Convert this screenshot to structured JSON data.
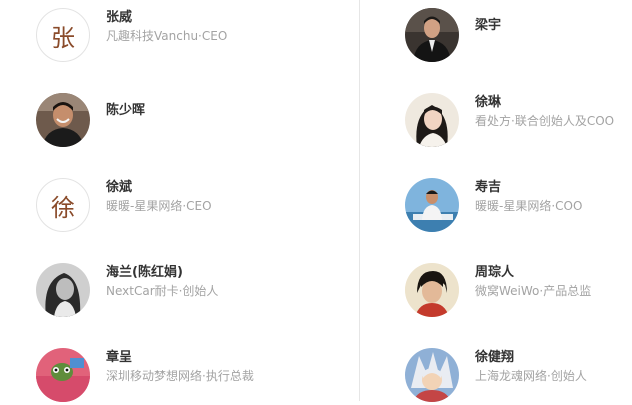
{
  "people": [
    {
      "name": "张威",
      "title": "凡趣科技Vanchu·CEO",
      "avatar_char": "张",
      "avatar_icon": "portrait-photo-icon"
    },
    {
      "name": "梁宇",
      "title": "",
      "avatar_icon": "portrait-photo-icon"
    },
    {
      "name": "陈少晖",
      "title": "",
      "avatar_icon": "portrait-photo-icon"
    },
    {
      "name": "徐琳",
      "title": "看处方·联合创始人及COO",
      "avatar_icon": "portrait-photo-icon"
    },
    {
      "name": "徐斌",
      "title": "暖暖-星果网络·CEO",
      "avatar_char": "徐",
      "avatar_icon": "portrait-photo-icon"
    },
    {
      "name": "寿吉",
      "title": "暖暖-星果网络·COO",
      "avatar_icon": "portrait-photo-icon"
    },
    {
      "name": "海兰(陈红娟)",
      "title": "NextCar耐卡·创始人",
      "avatar_icon": "portrait-photo-icon"
    },
    {
      "name": "周琮人",
      "title": "微窝WeiWo·产品总监",
      "avatar_icon": "portrait-photo-icon"
    },
    {
      "name": "章呈",
      "title": "深圳移动梦想网络·执行总裁",
      "avatar_icon": "portrait-photo-icon"
    },
    {
      "name": "徐健翔",
      "title": "上海龙魂网络·创始人",
      "avatar_icon": "portrait-photo-icon"
    }
  ],
  "colors": {
    "name_text": "#333333",
    "title_text": "#a3a3a3",
    "divider": "#e6e6e6",
    "avatar_char": "#8a4b2a"
  }
}
